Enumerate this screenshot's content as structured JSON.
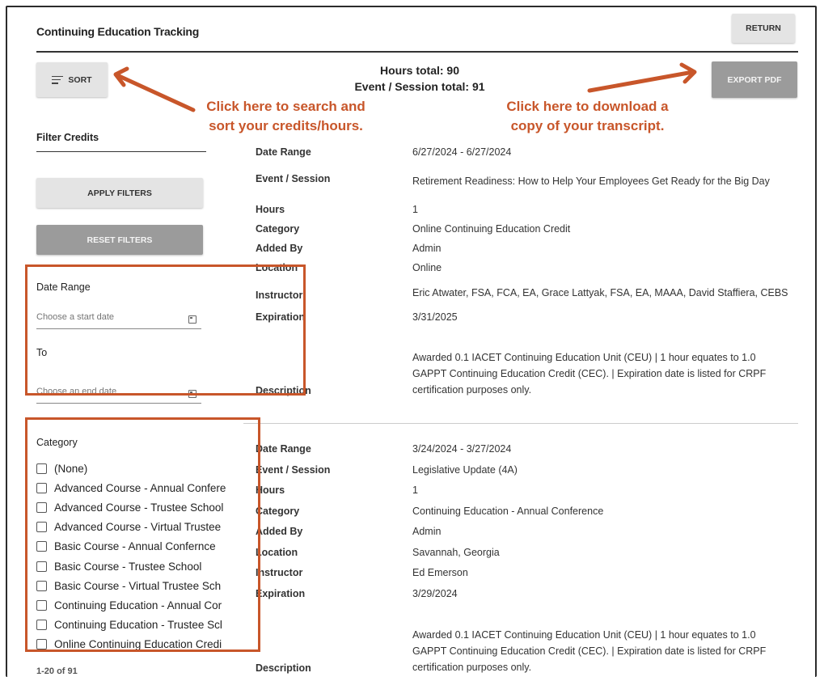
{
  "header": {
    "title": "Continuing Education Tracking",
    "return_label": "RETURN"
  },
  "toolbar": {
    "sort_label": "SORT",
    "export_label": "EXPORT PDF"
  },
  "totals": {
    "hours": "Hours total: 90",
    "events": "Event / Session total: 91"
  },
  "annotations": {
    "left_line1": "Click here to search and",
    "left_line2": "sort your credits/hours.",
    "right_line1": "Click here to download a",
    "right_line2": "copy of your transcript.",
    "color": "#c8562a"
  },
  "filters": {
    "title": "Filter Credits",
    "apply_label": "APPLY FILTERS",
    "reset_label": "RESET FILTERS",
    "date_range_label": "Date Range",
    "start_placeholder": "Choose a start date",
    "to_label": "To",
    "end_placeholder": "Choose an end date",
    "category_label": "Category",
    "categories": [
      "(None)",
      "Advanced Course - Annual Confere",
      "Advanced Course - Trustee School",
      "Advanced Course - Virtual Trustee",
      "Basic Course - Annual Confernce",
      "Basic Course - Trustee School",
      "Basic Course - Virtual Trustee Sch",
      "Continuing Education - Annual Cor",
      "Continuing Education - Trustee Scl",
      "Online Continuing Education Credi"
    ]
  },
  "labels": {
    "date_range": "Date Range",
    "event": "Event / Session",
    "hours": "Hours",
    "category": "Category",
    "added_by": "Added By",
    "location": "Location",
    "instructor": "Instructor",
    "expiration": "Expiration",
    "description": "Description"
  },
  "records": [
    {
      "date_range": "6/27/2024 - 6/27/2024",
      "event": "Retirement Readiness: How to Help Your Employees Get Ready for the Big Day",
      "hours": "1",
      "category": "Online Continuing Education Credit",
      "added_by": "Admin",
      "location": "Online",
      "instructor": "Eric Atwater, FSA, FCA, EA, Grace Lattyak, FSA, EA, MAAA, David Staffiera, CEBS",
      "expiration": "3/31/2025",
      "description": "Awarded 0.1 IACET Continuing Education Unit (CEU) | 1 hour equates to 1.0 GAPPT Continuing Education Credit (CEC). | Expiration date is listed for CRPF certification purposes only."
    },
    {
      "date_range": "3/24/2024 - 3/27/2024",
      "event": "Legislative Update (4A)",
      "hours": "1",
      "category": "Continuing Education - Annual Conference",
      "added_by": "Admin",
      "location": "Savannah, Georgia",
      "instructor": "Ed Emerson",
      "expiration": "3/29/2024",
      "description": "Awarded 0.1 IACET Continuing Education Unit (CEU) | 1 hour equates to 1.0 GAPPT Continuing Education Credit (CEC). | Expiration date is listed for CRPF certification purposes only."
    }
  ],
  "trailer_text": "1-20 of 91"
}
